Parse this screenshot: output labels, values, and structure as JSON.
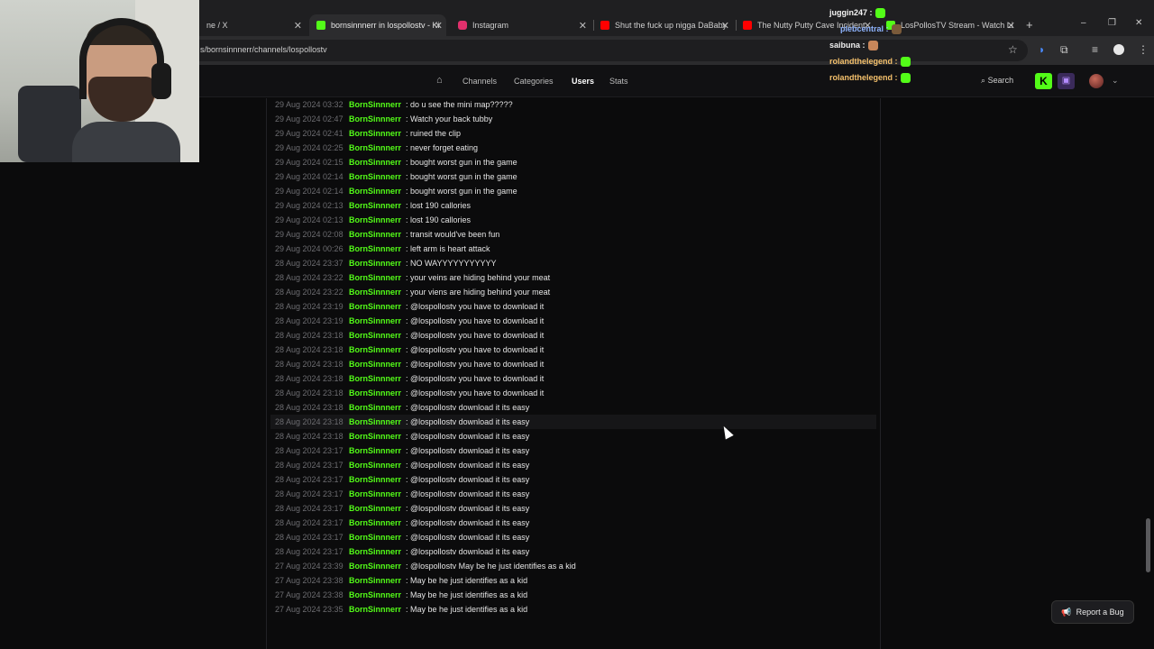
{
  "browser": {
    "tabs": [
      {
        "title": "ne / X",
        "favicon_color": "#2c2c2e"
      },
      {
        "title": "bornsinnnerr in lospollostv - Ki",
        "favicon_color": "#53fc18"
      },
      {
        "title": "Instagram",
        "favicon_color": "#e1306c"
      },
      {
        "title": "Shut the fuck up nigga DaBaby",
        "favicon_color": "#ff0000"
      },
      {
        "title": "The Nutty Putty Cave Incident",
        "favicon_color": "#ff0000"
      },
      {
        "title": "LosPollosTV Stream - Watch Li",
        "favicon_color": "#53fc18"
      }
    ],
    "new_tab": "+",
    "url": "s/bornsinnnerr/channels/lospollostv",
    "window_controls": {
      "minimize": "–",
      "maximize": "❐",
      "close": "✕"
    }
  },
  "site": {
    "nav": {
      "home_icon": "home-icon",
      "channels": "Channels",
      "categories": "Categories",
      "users": "Users",
      "stats": "Stats"
    },
    "search_label": "Search",
    "kick_label": "K",
    "twitch_label": "▣",
    "chevron": "⌄"
  },
  "chat_overlay": [
    {
      "user": "juggin247 :",
      "color": "#f5f5f5",
      "emote": "#53fc18"
    },
    {
      "user": "plebcentral :",
      "color": "#8fb4ff",
      "emote": "#7a5a3a"
    },
    {
      "user": "saibuna :",
      "color": "#f0f0f0",
      "emote": "#c8865a"
    },
    {
      "user": "rolandthelegend :",
      "color": "#f5c16c",
      "emote": "#53fc18"
    },
    {
      "user": "rolandthelegend :",
      "color": "#f5c16c",
      "emote": "#53fc18"
    }
  ],
  "messages": [
    {
      "ts": "29 Aug 2024 03:32",
      "user": "BornSinnnerr",
      "msg": ": do u see the mini map?????"
    },
    {
      "ts": "29 Aug 2024 02:47",
      "user": "BornSinnnerr",
      "msg": ": Watch your back tubby"
    },
    {
      "ts": "29 Aug 2024 02:41",
      "user": "BornSinnnerr",
      "msg": ": ruined the clip"
    },
    {
      "ts": "29 Aug 2024 02:25",
      "user": "BornSinnnerr",
      "msg": ": never forget eating"
    },
    {
      "ts": "29 Aug 2024 02:15",
      "user": "BornSinnnerr",
      "msg": ": bought worst gun in the game"
    },
    {
      "ts": "29 Aug 2024 02:14",
      "user": "BornSinnnerr",
      "msg": ": bought worst gun in the game"
    },
    {
      "ts": "29 Aug 2024 02:14",
      "user": "BornSinnnerr",
      "msg": ": bought worst gun in the game"
    },
    {
      "ts": "29 Aug 2024 02:13",
      "user": "BornSinnnerr",
      "msg": ": lost 190 callories"
    },
    {
      "ts": "29 Aug 2024 02:13",
      "user": "BornSinnnerr",
      "msg": ": lost 190 callories"
    },
    {
      "ts": "29 Aug 2024 02:08",
      "user": "BornSinnnerr",
      "msg": ": transit would've been fun"
    },
    {
      "ts": "29 Aug 2024 00:26",
      "user": "BornSinnnerr",
      "msg": ": left arm is heart attack"
    },
    {
      "ts": "28 Aug 2024 23:37",
      "user": "BornSinnnerr",
      "msg": ": NO WAYYYYYYYYYYY"
    },
    {
      "ts": "28 Aug 2024 23:22",
      "user": "BornSinnnerr",
      "msg": ": your veins are hiding behind your meat"
    },
    {
      "ts": "28 Aug 2024 23:22",
      "user": "BornSinnnerr",
      "msg": ": your viens are hiding behind your meat"
    },
    {
      "ts": "28 Aug 2024 23:19",
      "user": "BornSinnnerr",
      "msg": ": @lospollostv you have to download it"
    },
    {
      "ts": "28 Aug 2024 23:19",
      "user": "BornSinnnerr",
      "msg": ": @lospollostv you have to download it"
    },
    {
      "ts": "28 Aug 2024 23:18",
      "user": "BornSinnnerr",
      "msg": ": @lospollostv you have to download it"
    },
    {
      "ts": "28 Aug 2024 23:18",
      "user": "BornSinnnerr",
      "msg": ": @lospollostv you have to download it"
    },
    {
      "ts": "28 Aug 2024 23:18",
      "user": "BornSinnnerr",
      "msg": ": @lospollostv you have to download it"
    },
    {
      "ts": "28 Aug 2024 23:18",
      "user": "BornSinnnerr",
      "msg": ": @lospollostv you have to download it"
    },
    {
      "ts": "28 Aug 2024 23:18",
      "user": "BornSinnnerr",
      "msg": ": @lospollostv you have to download it"
    },
    {
      "ts": "28 Aug 2024 23:18",
      "user": "BornSinnnerr",
      "msg": ": @lospollostv download it its easy"
    },
    {
      "ts": "28 Aug 2024 23:18",
      "user": "BornSinnnerr",
      "msg": ": @lospollostv download it its easy"
    },
    {
      "ts": "28 Aug 2024 23:18",
      "user": "BornSinnnerr",
      "msg": ": @lospollostv download it its easy"
    },
    {
      "ts": "28 Aug 2024 23:17",
      "user": "BornSinnnerr",
      "msg": ": @lospollostv download it its easy"
    },
    {
      "ts": "28 Aug 2024 23:17",
      "user": "BornSinnnerr",
      "msg": ": @lospollostv download it its easy"
    },
    {
      "ts": "28 Aug 2024 23:17",
      "user": "BornSinnnerr",
      "msg": ": @lospollostv download it its easy"
    },
    {
      "ts": "28 Aug 2024 23:17",
      "user": "BornSinnnerr",
      "msg": ": @lospollostv download it its easy"
    },
    {
      "ts": "28 Aug 2024 23:17",
      "user": "BornSinnnerr",
      "msg": ": @lospollostv download it its easy"
    },
    {
      "ts": "28 Aug 2024 23:17",
      "user": "BornSinnnerr",
      "msg": ": @lospollostv download it its easy"
    },
    {
      "ts": "28 Aug 2024 23:17",
      "user": "BornSinnnerr",
      "msg": ": @lospollostv download it its easy"
    },
    {
      "ts": "28 Aug 2024 23:17",
      "user": "BornSinnnerr",
      "msg": ": @lospollostv download it its easy"
    },
    {
      "ts": "27 Aug 2024 23:39",
      "user": "BornSinnnerr",
      "msg": ": @lospollostv May be he just identifies as a kid"
    },
    {
      "ts": "27 Aug 2024 23:38",
      "user": "BornSinnnerr",
      "msg": ": May be he just identifies as a kid"
    },
    {
      "ts": "27 Aug 2024 23:38",
      "user": "BornSinnnerr",
      "msg": ": May be he just identifies as a kid"
    },
    {
      "ts": "27 Aug 2024 23:35",
      "user": "BornSinnnerr",
      "msg": ": May be he just identifies as a kid"
    }
  ],
  "report_bug_label": "Report a Bug",
  "colors": {
    "accent": "#53fc18",
    "background": "#0b0b0c",
    "timestamp": "#6c6c70"
  }
}
